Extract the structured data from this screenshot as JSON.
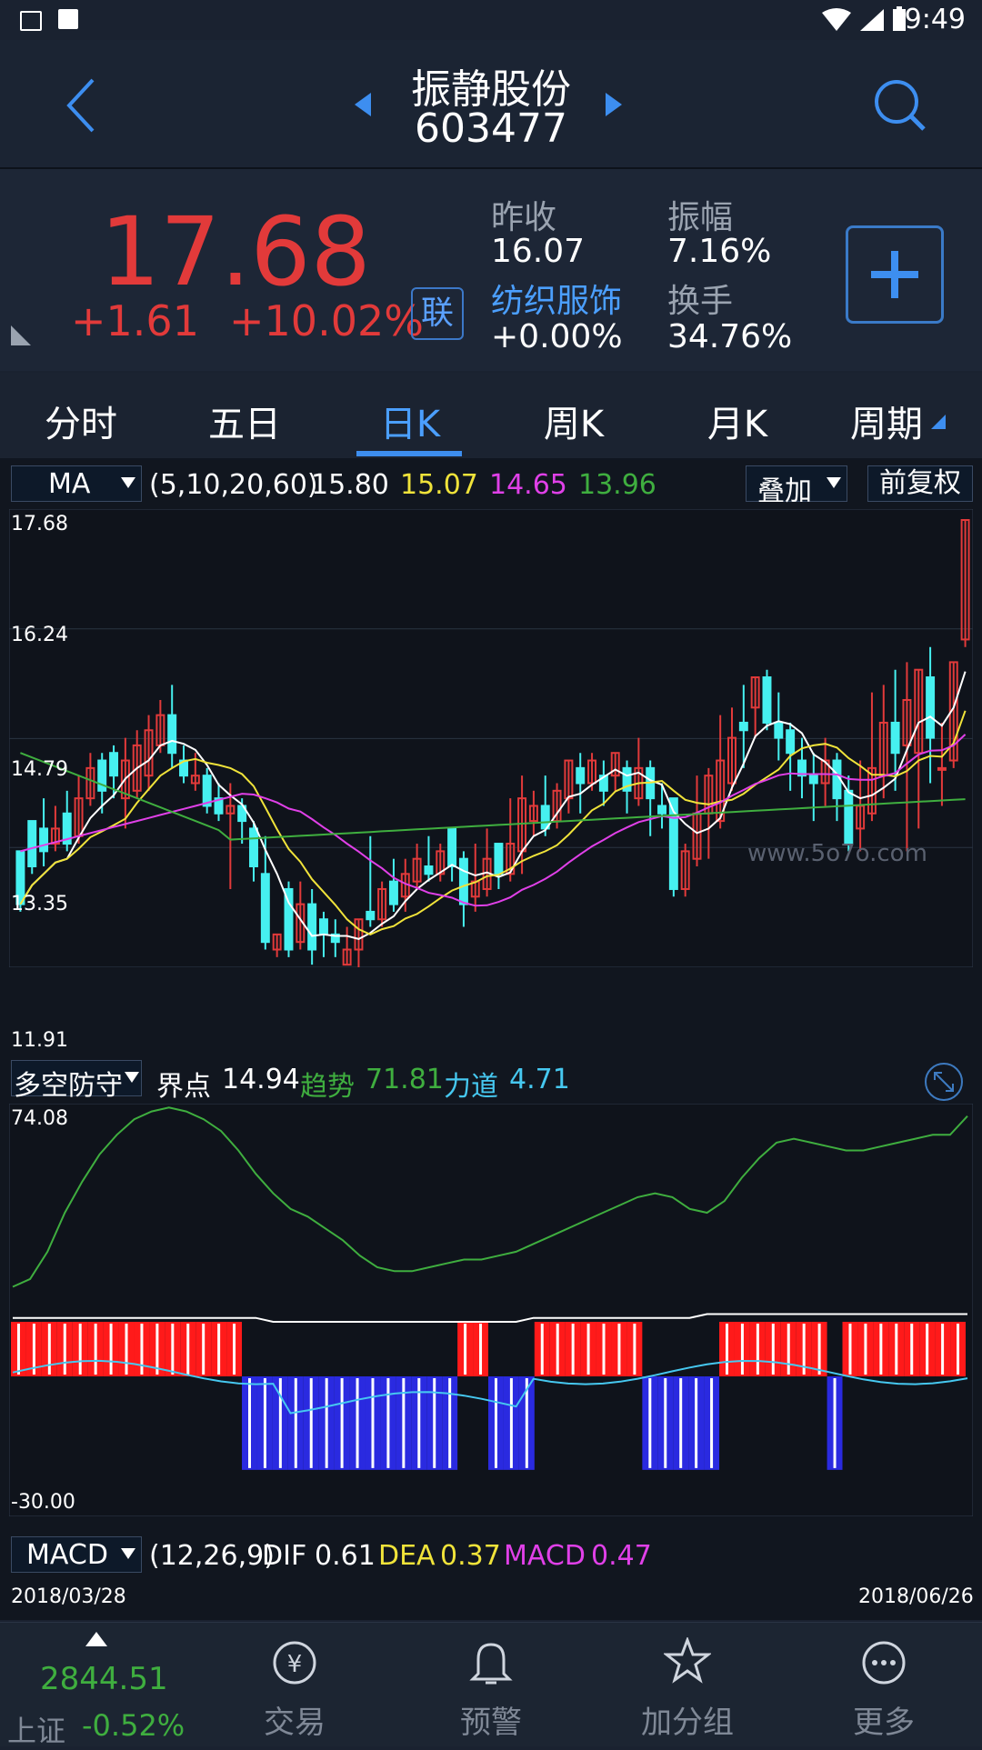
{
  "status": {
    "time": "9:49"
  },
  "header": {
    "stock_name": "振静股份",
    "stock_code": "603477"
  },
  "quote": {
    "price": "17.68",
    "change": "+1.61",
    "change_pct": "+10.02%",
    "lian_label": "联",
    "prev_close_label": "昨收",
    "prev_close": "16.07",
    "amplitude_label": "振幅",
    "amplitude": "7.16%",
    "sector": "纺织服饰",
    "sector_change": "+0.00%",
    "turnover_label": "换手",
    "turnover": "34.76%"
  },
  "tabs": [
    {
      "label": "分时"
    },
    {
      "label": "五日"
    },
    {
      "label": "日K",
      "active": true
    },
    {
      "label": "周K"
    },
    {
      "label": "月K"
    },
    {
      "label": "周期"
    }
  ],
  "ma_bar": {
    "selector": "MA",
    "params": "(5,10,20,60)",
    "ma5": "15.80",
    "ma10": "15.07",
    "ma20": "14.65",
    "ma60": "13.96",
    "overlay_btn": "叠加",
    "adjust_btn": "前复权"
  },
  "price_axis": [
    "17.68",
    "16.24",
    "14.79",
    "13.35",
    "11.91"
  ],
  "watermark": "www.5o7o.com",
  "indicator_bar": {
    "selector": "多空防守",
    "jiedian_label": "界点",
    "jiedian": "14.94",
    "qushi_label": "趋势",
    "qushi": "71.81",
    "lidao_label": "力道",
    "lidao": "4.71"
  },
  "indicator_axis": {
    "top": "74.08",
    "bottom": "-30.00"
  },
  "macd_bar": {
    "selector": "MACD",
    "params": "(12,26,9)",
    "dif_label": "DIF",
    "dif": "0.61",
    "dea_label": "DEA",
    "dea": "0.37",
    "macd_label": "MACD",
    "macd": "0.47"
  },
  "dates": {
    "start": "2018/03/28",
    "end": "2018/06/26"
  },
  "bottom_nav": {
    "index_value": "2844.51",
    "index_name": "上证",
    "index_change": "-0.52%",
    "items": [
      {
        "label": "交易"
      },
      {
        "label": "预警"
      },
      {
        "label": "加分组"
      },
      {
        "label": "更多"
      }
    ]
  },
  "colors": {
    "up": "#e23a3a",
    "down": "#46f0f0",
    "ma5": "#ffffff",
    "ma10": "#f0e33a",
    "ma20": "#e040e8",
    "ma60": "#3fae3f",
    "accent": "#3d8ef0"
  },
  "chart_data": {
    "type": "candlestick",
    "candles_ohlc": [
      [
        13.3,
        12.6,
        13.3,
        12.5
      ],
      [
        13.7,
        13.1,
        13.6,
        13.0
      ],
      [
        13.6,
        13.3,
        14.0,
        13.1
      ],
      [
        13.4,
        13.6,
        13.9,
        13.3
      ],
      [
        13.8,
        13.4,
        14.1,
        13.3
      ],
      [
        13.5,
        14.0,
        14.3,
        13.4
      ],
      [
        14.0,
        14.4,
        14.6,
        13.9
      ],
      [
        14.5,
        14.1,
        14.6,
        13.8
      ],
      [
        14.6,
        14.3,
        14.7,
        14.0
      ],
      [
        14.0,
        14.5,
        14.8,
        13.6
      ],
      [
        14.1,
        14.7,
        14.9,
        14.0
      ],
      [
        14.3,
        14.9,
        15.1,
        14.1
      ],
      [
        14.7,
        15.1,
        15.3,
        14.6
      ],
      [
        15.1,
        14.6,
        15.5,
        14.4
      ],
      [
        14.5,
        14.3,
        14.7,
        14.2
      ],
      [
        14.2,
        14.3,
        14.6,
        14.1
      ],
      [
        14.3,
        13.9,
        14.4,
        13.8
      ],
      [
        14.0,
        13.8,
        14.2,
        13.7
      ],
      [
        13.8,
        13.9,
        14.2,
        12.8
      ],
      [
        13.9,
        13.7,
        14.0,
        13.4
      ],
      [
        13.6,
        13.1,
        13.7,
        12.9
      ],
      [
        13.0,
        12.1,
        13.5,
        12.0
      ],
      [
        12.0,
        12.2,
        12.2,
        11.9
      ],
      [
        12.8,
        12.0,
        12.9,
        11.9
      ],
      [
        12.1,
        12.6,
        12.9,
        12.0
      ],
      [
        12.6,
        12.0,
        12.8,
        11.8
      ],
      [
        12.4,
        12.2,
        12.5,
        11.9
      ],
      [
        12.2,
        12.1,
        12.4,
        11.9
      ],
      [
        11.8,
        12.0,
        12.3,
        11.8
      ],
      [
        12.0,
        12.4,
        12.4,
        11.7
      ],
      [
        12.5,
        12.4,
        13.5,
        12.3
      ],
      [
        12.4,
        12.8,
        12.9,
        12.3
      ],
      [
        12.9,
        12.6,
        13.2,
        12.5
      ],
      [
        12.7,
        13.0,
        13.2,
        12.5
      ],
      [
        12.9,
        13.2,
        13.4,
        12.8
      ],
      [
        13.1,
        13.0,
        13.5,
        12.9
      ],
      [
        13.0,
        13.3,
        13.4,
        12.9
      ],
      [
        13.6,
        13.1,
        13.6,
        12.9
      ],
      [
        13.2,
        12.6,
        13.3,
        12.3
      ],
      [
        12.7,
        12.9,
        13.4,
        12.5
      ],
      [
        12.8,
        13.2,
        13.6,
        12.7
      ],
      [
        13.4,
        13.0,
        13.4,
        12.8
      ],
      [
        13.0,
        13.4,
        14.0,
        12.9
      ],
      [
        13.3,
        14.0,
        14.3,
        13.0
      ],
      [
        13.7,
        13.9,
        14.1,
        13.5
      ],
      [
        13.9,
        13.6,
        14.3,
        13.5
      ],
      [
        13.7,
        14.1,
        14.2,
        13.6
      ],
      [
        14.0,
        14.5,
        14.5,
        13.8
      ],
      [
        14.4,
        14.2,
        14.6,
        13.8
      ],
      [
        14.2,
        14.5,
        14.6,
        14.1
      ],
      [
        14.3,
        14.1,
        14.5,
        13.9
      ],
      [
        14.3,
        14.6,
        14.6,
        14.1
      ],
      [
        14.4,
        14.1,
        14.5,
        13.8
      ],
      [
        14.0,
        14.4,
        14.8,
        13.9
      ],
      [
        14.4,
        14.0,
        14.5,
        13.5
      ],
      [
        13.9,
        13.8,
        14.2,
        13.6
      ],
      [
        14.0,
        12.8,
        14.0,
        12.7
      ],
      [
        12.8,
        13.3,
        13.4,
        12.7
      ],
      [
        13.2,
        13.8,
        14.3,
        13.1
      ],
      [
        13.8,
        14.3,
        14.4,
        13.2
      ],
      [
        13.7,
        14.5,
        15.1,
        13.6
      ],
      [
        14.2,
        14.8,
        15.2,
        14.1
      ],
      [
        15.0,
        14.9,
        15.5,
        14.4
      ],
      [
        15.2,
        15.6,
        15.6,
        14.8
      ],
      [
        15.6,
        15.0,
        15.7,
        14.9
      ],
      [
        15.0,
        14.8,
        15.4,
        14.5
      ],
      [
        14.9,
        14.6,
        15.0,
        14.1
      ],
      [
        14.5,
        14.3,
        14.8,
        14.0
      ],
      [
        14.3,
        14.2,
        14.6,
        13.7
      ],
      [
        14.2,
        14.5,
        14.8,
        13.9
      ],
      [
        14.5,
        14.0,
        14.6,
        13.7
      ],
      [
        14.1,
        13.4,
        14.3,
        13.3
      ],
      [
        13.6,
        13.9,
        14.5,
        13.3
      ],
      [
        13.8,
        14.4,
        15.4,
        13.7
      ],
      [
        14.3,
        15.0,
        15.5,
        14.0
      ],
      [
        15.0,
        14.6,
        15.7,
        14.1
      ],
      [
        14.7,
        15.3,
        15.8,
        13.3
      ],
      [
        14.6,
        15.7,
        15.7,
        13.6
      ],
      [
        15.6,
        14.8,
        16.0,
        14.2
      ],
      [
        14.4,
        14.4,
        15.0,
        13.9
      ],
      [
        14.5,
        15.8,
        15.8,
        14.4
      ],
      [
        16.1,
        17.68,
        17.68,
        16.0
      ]
    ],
    "price_range": [
      11.91,
      17.68
    ],
    "series": [
      {
        "name": "MA5",
        "value": "15.80"
      },
      {
        "name": "MA10",
        "value": "15.07"
      },
      {
        "name": "MA20",
        "value": "14.65"
      },
      {
        "name": "MA60",
        "value": "13.96"
      }
    ],
    "indicator_range": [
      -30.0,
      74.08
    ],
    "trend_line": [
      28,
      30,
      37,
      47,
      55,
      62,
      67,
      71,
      73,
      74,
      73,
      71,
      68,
      63,
      57,
      52,
      48,
      46,
      43,
      40,
      36,
      33,
      32,
      32,
      33,
      34,
      35,
      35,
      36,
      37,
      39,
      41,
      43,
      45,
      47,
      49,
      51,
      52,
      51,
      48,
      47,
      50,
      56,
      61,
      65,
      66,
      65,
      64,
      63,
      63,
      64,
      65,
      66,
      67,
      67,
      71.81
    ],
    "regime": [
      1,
      1,
      1,
      1,
      1,
      1,
      1,
      1,
      1,
      1,
      1,
      1,
      1,
      1,
      1,
      -1,
      -1,
      -1,
      -1,
      -1,
      -1,
      -1,
      -1,
      -1,
      -1,
      -1,
      -1,
      -1,
      -1,
      1,
      1,
      -1,
      -1,
      -1,
      1,
      1,
      1,
      1,
      1,
      1,
      1,
      -1,
      -1,
      -1,
      -1,
      -1,
      1,
      1,
      1,
      1,
      1,
      1,
      1,
      -1,
      1,
      1,
      1,
      1,
      1,
      1,
      1,
      1
    ]
  }
}
